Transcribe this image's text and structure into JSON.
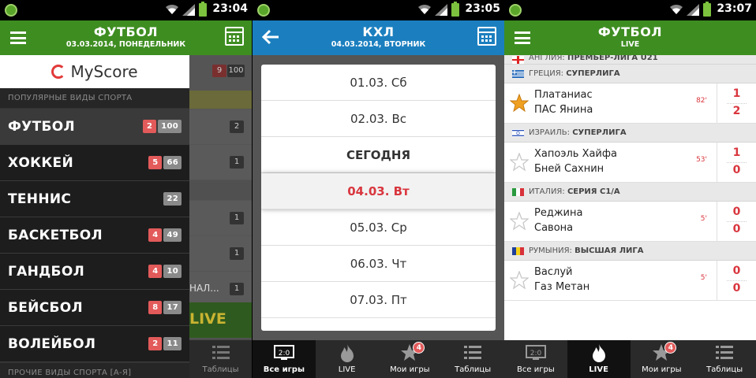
{
  "status": [
    {
      "time": "23:04"
    },
    {
      "time": "23:05"
    },
    {
      "time": "23:07"
    }
  ],
  "colors": {
    "green_header": "#3e8d21",
    "blue_header": "#1b7fbf",
    "accent_red": "#d9363e",
    "drawer_bg": "#1d1d1d"
  },
  "panel1": {
    "header": {
      "title": "ФУТБОЛ",
      "subtitle": "03.03.2014, ПОНЕДЕЛЬНИК"
    },
    "drawer": {
      "logo_text": "MyScore",
      "popular_title": "ПОПУЛЯРНЫЕ ВИДЫ СПОРТА",
      "sports": [
        {
          "name": "ФУТБОЛ",
          "live": "2",
          "total": "100"
        },
        {
          "name": "ХОККЕЙ",
          "live": "5",
          "total": "66"
        },
        {
          "name": "ТЕННИС",
          "live": "",
          "total": "22"
        },
        {
          "name": "БАСКЕТБОЛ",
          "live": "4",
          "total": "49"
        },
        {
          "name": "ГАНДБОЛ",
          "live": "4",
          "total": "10"
        },
        {
          "name": "БЕЙСБОЛ",
          "live": "8",
          "total": "17"
        },
        {
          "name": "ВОЛЕЙБОЛ",
          "live": "2",
          "total": "11"
        }
      ],
      "other_title": "ПРОЧИЕ ВИДЫ СПОРТА [А-Я]"
    },
    "background": {
      "top_badge_red": "9",
      "top_badge_gray": "100",
      "badges": [
        "2",
        "1",
        "1",
        "1",
        "1"
      ],
      "partial_text": "НАЛ...",
      "live_text": "LIVE",
      "nav_label": "Таблицы"
    }
  },
  "panel2": {
    "header": {
      "title": "КХЛ",
      "subtitle": "04.03.2014, ВТОРНИК"
    },
    "dates": [
      {
        "label": "01.03. Сб"
      },
      {
        "label": "02.03. Вс"
      },
      {
        "label": "СЕГОДНЯ"
      },
      {
        "label": "04.03. Вт"
      },
      {
        "label": "05.03. Ср"
      },
      {
        "label": "06.03. Чт"
      },
      {
        "label": "07.03. Пт"
      }
    ],
    "nav": [
      {
        "label": "Все игры",
        "icon": "scoreboard-icon"
      },
      {
        "label": "LIVE",
        "icon": "fire-icon"
      },
      {
        "label": "Мои игры",
        "icon": "star-icon",
        "badge": "4"
      },
      {
        "label": "Таблицы",
        "icon": "table-list-icon"
      }
    ]
  },
  "panel3": {
    "header": {
      "title": "ФУТБОЛ",
      "subtitle": "LIVE"
    },
    "top_league": {
      "country": "АНГЛИЯ:",
      "name": "ПРЕМЬЕР-ЛИГА U21"
    },
    "leagues": [
      {
        "country": "ГРЕЦИЯ:",
        "name": "СУПЕРЛИГА",
        "home": "Платаниас",
        "away": "ПАС Янина",
        "minute": "82'",
        "home_score": "1",
        "away_score": "2",
        "favorite": true
      },
      {
        "country": "ИЗРАИЛЬ:",
        "name": "СУПЕРЛИГА",
        "home": "Хапоэль Хайфа",
        "away": "Бней Сахнин",
        "minute": "53'",
        "home_score": "1",
        "away_score": "0",
        "favorite": false
      },
      {
        "country": "ИТАЛИЯ:",
        "name": "СЕРИЯ С1/А",
        "home": "Реджина",
        "away": "Савона",
        "minute": "5'",
        "home_score": "0",
        "away_score": "0",
        "favorite": false
      },
      {
        "country": "РУМЫНИЯ:",
        "name": "ВЫСШАЯ ЛИГА",
        "home": "Васлуй",
        "away": "Газ Метан",
        "minute": "5'",
        "home_score": "0",
        "away_score": "0",
        "favorite": false
      }
    ],
    "nav": [
      {
        "label": "Все игры",
        "icon": "scoreboard-icon"
      },
      {
        "label": "LIVE",
        "icon": "fire-icon"
      },
      {
        "label": "Мои игры",
        "icon": "star-icon",
        "badge": "4"
      },
      {
        "label": "Таблицы",
        "icon": "table-list-icon"
      }
    ]
  }
}
